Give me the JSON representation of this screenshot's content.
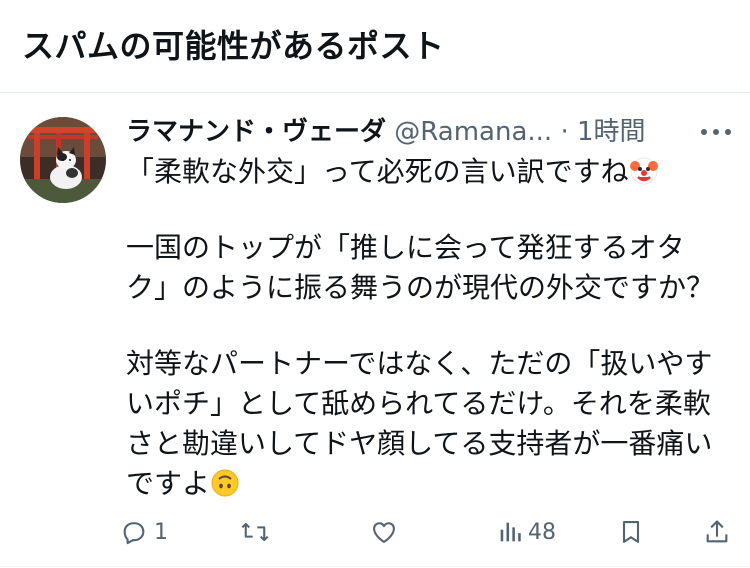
{
  "header": {
    "title": "スパムの可能性があるポスト"
  },
  "post": {
    "display_name": "ラマナンド・ヴェーダ",
    "handle": "@Ramana...",
    "separator": "·",
    "timestamp": "1時間",
    "line1": "「柔軟な外交」って必死の言い訳ですね",
    "line1_emoji": "clown-face-emoji",
    "para2_line1": "一国のトップが「推しに会って発狂するオタ",
    "para2_line2": "ク」のように振る舞うのが現代の外交ですか？",
    "para3_line1": "対等なパートナーではなく、ただの「扱いやす",
    "para3_line2": "いポチ」として舐められてるだけ。それを柔軟",
    "para3_line3": "さと勘違いしてドヤ顔してる支持者が一番痛い",
    "para3_line4": "ですよ",
    "para3_emoji": "upside-down-face-emoji"
  },
  "actions": {
    "reply_count": "1",
    "retweet_count": "",
    "like_count": "",
    "views_count": "48"
  },
  "icons": {
    "more": "more-dots-icon",
    "reply": "reply-icon",
    "retweet": "retweet-icon",
    "like": "heart-icon",
    "views": "views-chart-icon",
    "bookmark": "bookmark-icon",
    "share": "share-icon"
  },
  "colors": {
    "text_primary": "#0f1419",
    "text_secondary": "#536471",
    "divider": "#e6ecf0"
  }
}
